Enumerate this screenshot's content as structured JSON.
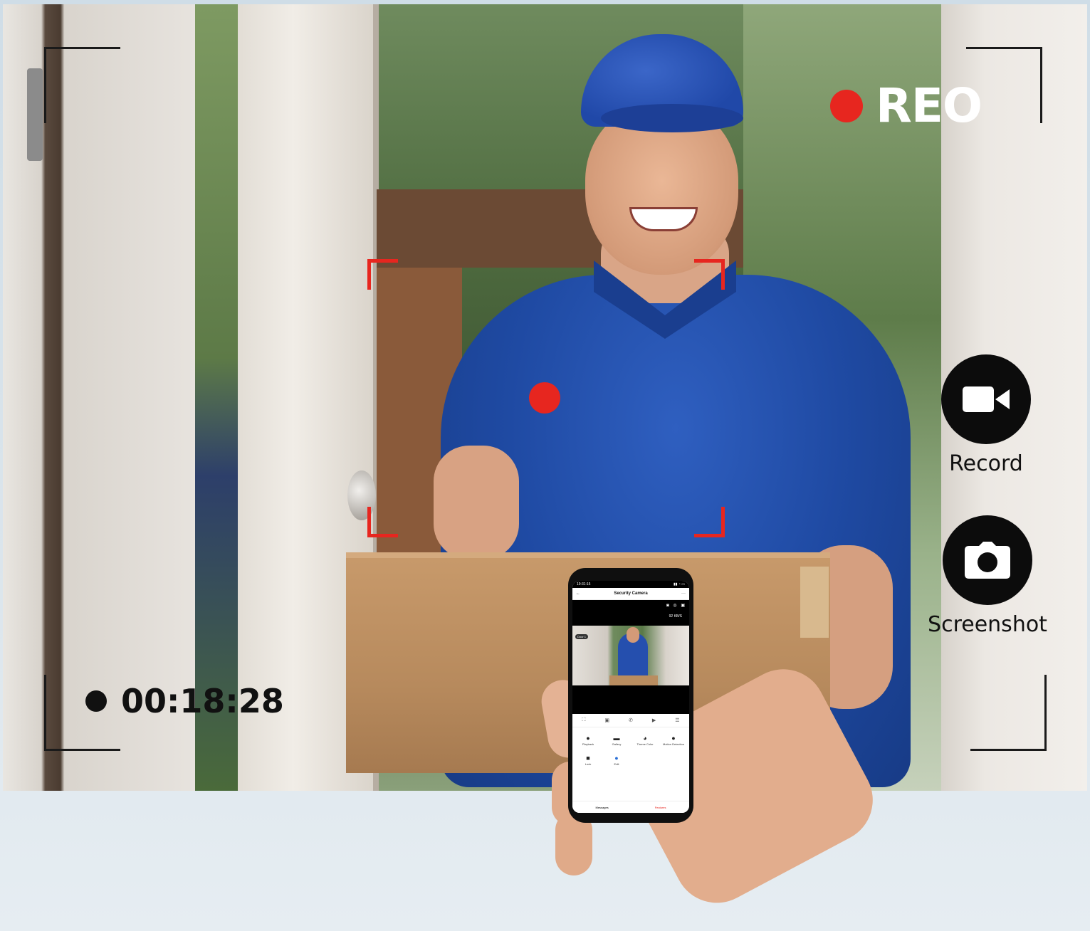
{
  "overlay": {
    "rec_label": "REO",
    "timer": "00:18:28",
    "actions": [
      {
        "label": "Record",
        "icon": "video-camera-icon"
      },
      {
        "label": "Screenshot",
        "icon": "camera-icon"
      }
    ]
  },
  "colors": {
    "accent_red": "#e7261f",
    "button_black": "#0c0c0c",
    "frame_corners": "#1a1a1a"
  },
  "phone": {
    "status_time": "19:31:15",
    "app_title": "Security Camera",
    "speed": "92 KB/S",
    "camera_tag": "Door 1",
    "features": [
      {
        "label": "Playback",
        "icon": "play-icon"
      },
      {
        "label": "Gallery",
        "icon": "gallery-icon"
      },
      {
        "label": "Theme Color",
        "icon": "palette-icon"
      },
      {
        "label": "Motion Detection",
        "icon": "motion-icon"
      },
      {
        "label": "Lock",
        "icon": "lock-icon"
      },
      {
        "label": "Edit",
        "icon": "edit-icon"
      }
    ],
    "tabs": [
      {
        "label": "Messages",
        "icon": "bell-icon"
      },
      {
        "label": "Features",
        "icon": "features-icon"
      }
    ]
  }
}
